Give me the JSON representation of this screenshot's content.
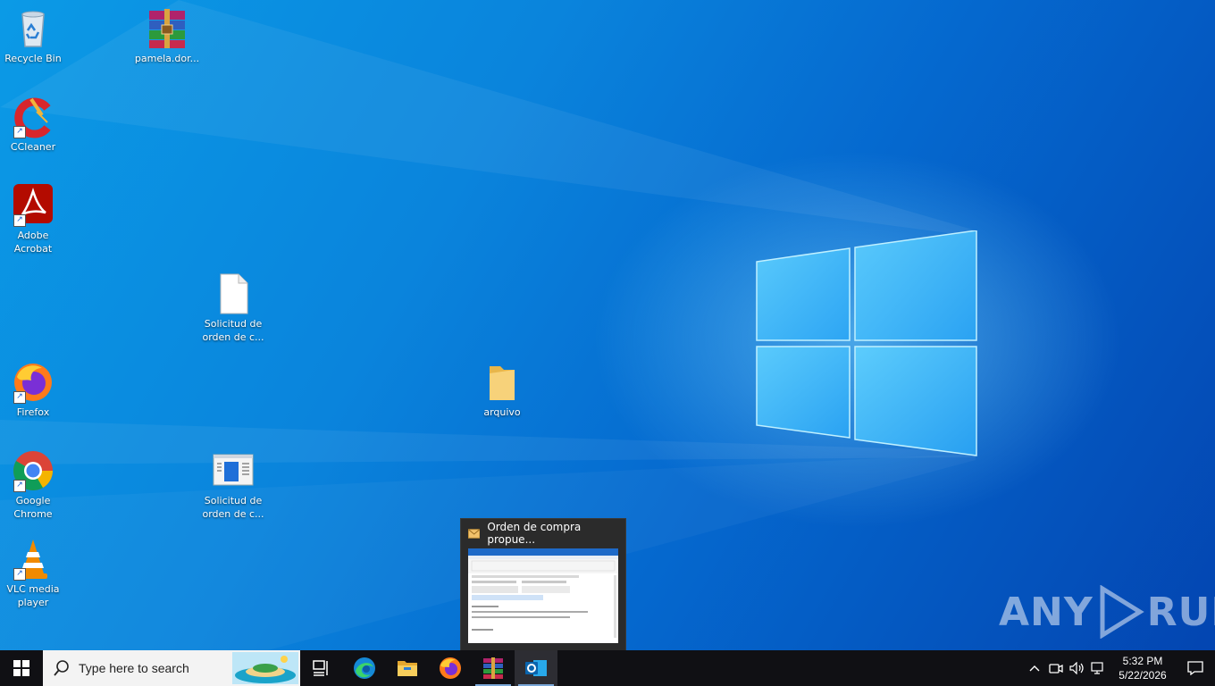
{
  "desktop": {
    "icons": [
      {
        "label": "Recycle Bin"
      },
      {
        "label": "pamela.dor..."
      },
      {
        "label": "CCleaner"
      },
      {
        "label": "Adobe Acrobat"
      },
      {
        "label": "Solicitud de orden de c..."
      },
      {
        "label": "Firefox"
      },
      {
        "label": "arquivo"
      },
      {
        "label": "Google Chrome"
      },
      {
        "label": "Solicitud de orden de c..."
      },
      {
        "label": "VLC media player"
      }
    ]
  },
  "preview": {
    "title": "Orden de compra propue..."
  },
  "watermark": {
    "text_left": "ANY",
    "text_right": "RUN"
  },
  "taskbar": {
    "search_placeholder": "Type here to search",
    "apps": [
      "task-view",
      "edge",
      "file-explorer",
      "firefox",
      "winrar",
      "outlook"
    ],
    "clock_time": "5:32 PM",
    "clock_date": "5/22/2026"
  },
  "colors": {
    "accent": "#0a84dc",
    "taskbar": "#101014"
  }
}
